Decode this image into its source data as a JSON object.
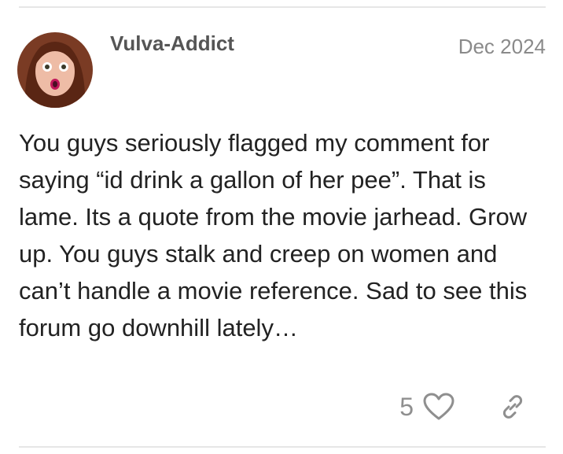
{
  "post": {
    "username": "Vulva-Addict",
    "date": "Dec 2024",
    "body": "You guys seriously flagged my comment for saying “id drink a gallon of her pee”. That is lame. Its a quote from the movie jarhead. Grow up. You guys stalk and creep on women and can’t handle a movie reference. Sad to see this forum go downhill lately…",
    "like_count": "5",
    "avatar_icon": "user-avatar-photo",
    "like_icon": "heart-outline-icon",
    "share_icon": "link-icon"
  },
  "colors": {
    "username": "#555555",
    "date": "#8a8a8a",
    "body_text": "#222222",
    "action_icons": "#8f8f8f",
    "divider": "#e6e6e6"
  }
}
